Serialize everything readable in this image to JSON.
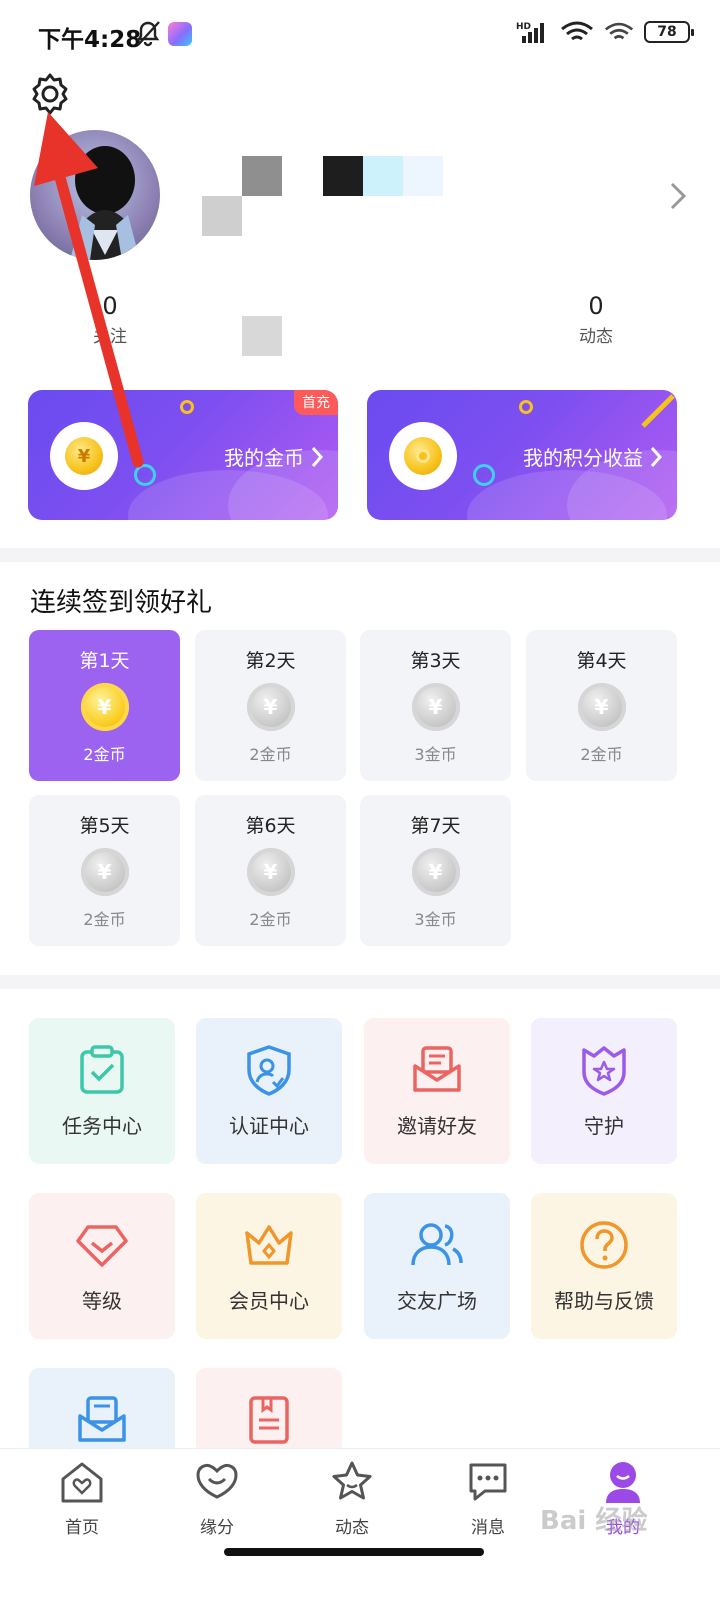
{
  "status_bar": {
    "time": "下午4:28",
    "battery": "78",
    "network": "HD"
  },
  "profile": {
    "stats": [
      {
        "value": "0",
        "label": "关注"
      },
      {
        "value": "0",
        "label": "动态"
      }
    ]
  },
  "wallet": {
    "coins": {
      "label": "我的金币",
      "badge": "首充",
      "coin_symbol": "¥"
    },
    "points": {
      "label": "我的积分收益"
    }
  },
  "signin": {
    "title": "连续签到领好礼",
    "coin_symbol": "¥",
    "days": [
      {
        "day": "第1天",
        "reward": "2金币",
        "active": true
      },
      {
        "day": "第2天",
        "reward": "2金币",
        "active": false
      },
      {
        "day": "第3天",
        "reward": "3金币",
        "active": false
      },
      {
        "day": "第4天",
        "reward": "2金币",
        "active": false
      },
      {
        "day": "第5天",
        "reward": "2金币",
        "active": false
      },
      {
        "day": "第6天",
        "reward": "2金币",
        "active": false
      },
      {
        "day": "第7天",
        "reward": "3金币",
        "active": false
      }
    ]
  },
  "features": [
    {
      "label": "任务中心",
      "icon": "task-clipboard-icon",
      "color": "#3cc7a8",
      "bg": "#eaf8f4"
    },
    {
      "label": "认证中心",
      "icon": "verified-shield-icon",
      "color": "#3a93e6",
      "bg": "#e9f1fa"
    },
    {
      "label": "邀请好友",
      "icon": "invite-envelope-icon",
      "color": "#ec6461",
      "bg": "#fdf0f0"
    },
    {
      "label": "守护",
      "icon": "guard-star-shield-icon",
      "color": "#9b5ae8",
      "bg": "#f3effc"
    },
    {
      "label": "等级",
      "icon": "level-diamond-icon",
      "color": "#ec6461",
      "bg": "#fdf0f0"
    },
    {
      "label": "会员中心",
      "icon": "vip-crown-icon",
      "color": "#f0962a",
      "bg": "#fdf5e4"
    },
    {
      "label": "交友广场",
      "icon": "friends-users-icon",
      "color": "#3a93e6",
      "bg": "#e9f1fa"
    },
    {
      "label": "帮助与反馈",
      "icon": "help-question-icon",
      "color": "#f0962a",
      "bg": "#fdf5e4"
    },
    {
      "label": "",
      "icon": "mail-icon",
      "color": "#3a93e6",
      "bg": "#e9f1fa"
    },
    {
      "label": "",
      "icon": "document-icon",
      "color": "#ec6461",
      "bg": "#fdf0f0"
    }
  ],
  "nav": [
    {
      "label": "首页",
      "icon": "home-heart-icon"
    },
    {
      "label": "缘分",
      "icon": "fate-heart-chat-icon"
    },
    {
      "label": "动态",
      "icon": "moments-star-icon"
    },
    {
      "label": "消息",
      "icon": "message-bubble-icon"
    },
    {
      "label": "我的",
      "icon": "profile-me-icon",
      "active": true
    }
  ],
  "colors": {
    "accent": "#9b63f0",
    "annotation_arrow": "#e8332a"
  },
  "watermark": "Bai 经验"
}
